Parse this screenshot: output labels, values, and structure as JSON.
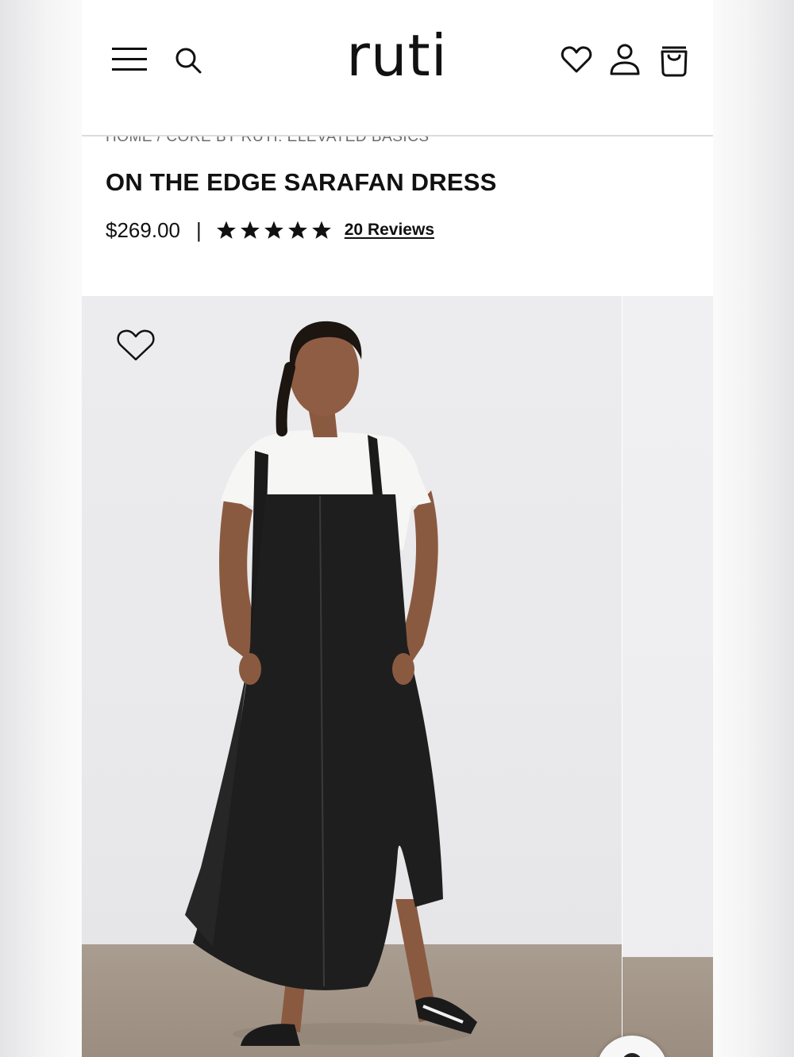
{
  "header": {
    "logo": "ruti",
    "icons": [
      "menu-icon",
      "search-icon",
      "heart-icon",
      "account-icon",
      "shopping-bag-icon"
    ]
  },
  "breadcrumb": "HOME / CORE BY RUTI: ELEVATED BASICS",
  "product": {
    "title": "ON THE EDGE SARAFAN DRESS",
    "price": "$269.00",
    "separator": "|",
    "rating": 5,
    "rating_max": 5,
    "reviews_label": "20 Reviews"
  },
  "gallery": {
    "favorite_icon": "heart-outline-icon"
  },
  "colors": {
    "text": "#111111",
    "muted": "#6b6b6b",
    "background": "#ffffff"
  }
}
